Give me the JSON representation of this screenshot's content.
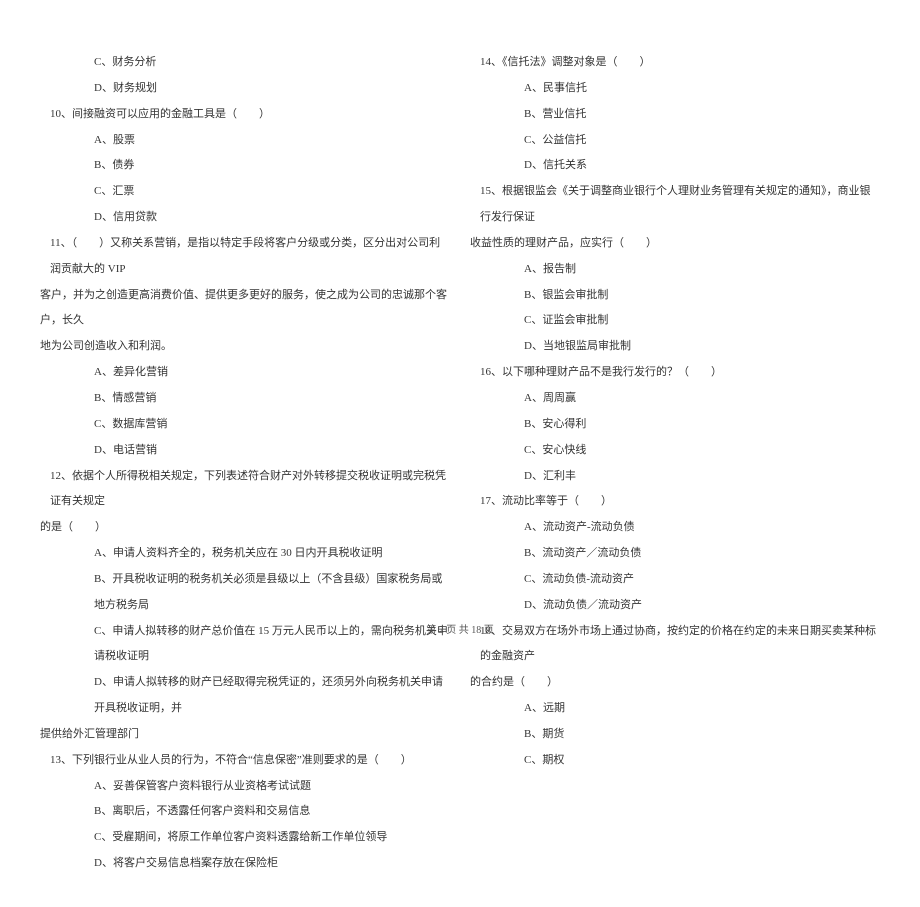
{
  "left": {
    "q9_c": "C、财务分析",
    "q9_d": "D、财务规划",
    "q10": "10、间接融资可以应用的金融工具是（　　）",
    "q10_a": "A、股票",
    "q10_b": "B、债券",
    "q10_c": "C、汇票",
    "q10_d": "D、信用贷款",
    "q11_line1": "11、（　　）又称关系营销，是指以特定手段将客户分级或分类，区分出对公司利润贡献大的 VIP",
    "q11_line2": "客户，并为之创造更高消费价值、提供更多更好的服务，使之成为公司的忠诚那个客户，长久",
    "q11_line3": "地为公司创造收入和利润。",
    "q11_a": "A、差异化营销",
    "q11_b": "B、情感营销",
    "q11_c": "C、数据库营销",
    "q11_d": "D、电话营销",
    "q12_line1": "12、依据个人所得税相关规定，下列表述符合财产对外转移提交税收证明或完税凭证有关规定",
    "q12_line2": "的是（　　）",
    "q12_a": "A、申请人资料齐全的，税务机关应在 30 日内开具税收证明",
    "q12_b": "B、开具税收证明的税务机关必须是县级以上（不含县级）国家税务局或地方税务局",
    "q12_c": "C、申请人拟转移的财产总价值在 15 万元人民币以上的，需向税务机关申请税收证明",
    "q12_d_line1": "D、申请人拟转移的财产已经取得完税凭证的，还须另外向税务机关申请开具税收证明，并",
    "q12_d_line2": "提供给外汇管理部门",
    "q13": "13、下列银行业从业人员的行为，不符合“信息保密”准则要求的是（　　）",
    "q13_a": "A、妥善保管客户资料银行从业资格考试试题",
    "q13_b": "B、离职后，不透露任何客户资料和交易信息",
    "q13_c": "C、受雇期间，将原工作单位客户资料透露给新工作单位领导",
    "q13_d": "D、将客户交易信息档案存放在保险柜"
  },
  "right": {
    "q14": "14、《信托法》调整对象是（　　）",
    "q14_a": "A、民事信托",
    "q14_b": "B、营业信托",
    "q14_c": "C、公益信托",
    "q14_d": "D、信托关系",
    "q15_line1": "15、根据银监会《关于调整商业银行个人理财业务管理有关规定的通知》，商业银行发行保证",
    "q15_line2": "收益性质的理财产品，应实行（　　）",
    "q15_a": "A、报告制",
    "q15_b": "B、银监会审批制",
    "q15_c": "C、证监会审批制",
    "q15_d": "D、当地银监局审批制",
    "q16": "16、以下哪种理财产品不是我行发行的？（　　）",
    "q16_a": "A、周周赢",
    "q16_b": "B、安心得利",
    "q16_c": "C、安心快线",
    "q16_d": "D、汇利丰",
    "q17": "17、流动比率等于（　　）",
    "q17_a": "A、流动资产-流动负债",
    "q17_b": "B、流动资产／流动负债",
    "q17_c": "C、流动负债-流动资产",
    "q17_d": "D、流动负债／流动资产",
    "q18_line1": "18、交易双方在场外市场上通过协商，按约定的价格在约定的未来日期买卖某种标的金融资产",
    "q18_line2": "的合约是（　　）",
    "q18_a": "A、远期",
    "q18_b": "B、期货",
    "q18_c": "C、期权"
  },
  "footer": "第 2 页 共 18 页"
}
